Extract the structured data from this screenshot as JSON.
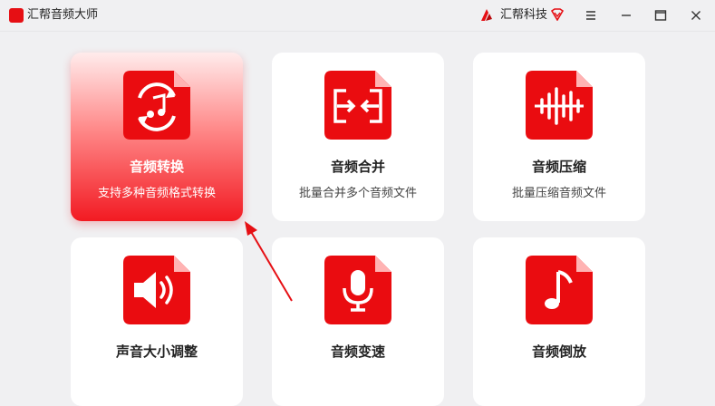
{
  "window": {
    "title": "汇帮音频大师",
    "brand": "汇帮科技",
    "colors": {
      "accent": "#e60f14",
      "background": "#f0f0f2",
      "card": "#ffffff"
    }
  },
  "controls": [
    "menu-icon",
    "minimize-icon",
    "maximize-icon",
    "close-icon"
  ],
  "cards": [
    {
      "title": "音频转换",
      "subtitle": "支持多种音频格式转换",
      "icon": "audio-convert-icon",
      "active": true
    },
    {
      "title": "音频合并",
      "subtitle": "批量合并多个音频文件",
      "icon": "audio-merge-icon",
      "active": false
    },
    {
      "title": "音频压缩",
      "subtitle": "批量压缩音频文件",
      "icon": "audio-compress-icon",
      "active": false
    },
    {
      "title": "声音大小调整",
      "subtitle": "",
      "icon": "volume-adjust-icon",
      "active": false
    },
    {
      "title": "音频变速",
      "subtitle": "",
      "icon": "audio-speed-icon",
      "active": false
    },
    {
      "title": "音频倒放",
      "subtitle": "",
      "icon": "audio-reverse-icon",
      "active": false
    }
  ]
}
